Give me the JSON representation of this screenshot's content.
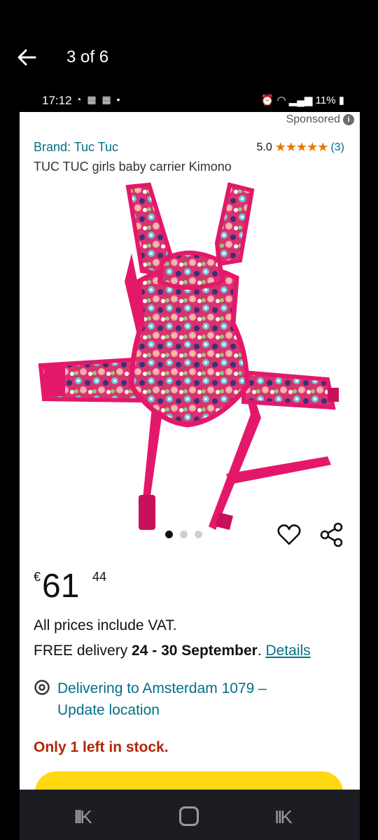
{
  "viewer": {
    "title": "3 of 6",
    "back_icon": "arrow-left-icon"
  },
  "status_bar": {
    "time": "17:12",
    "battery": "11%"
  },
  "product": {
    "sponsored": "Sponsored",
    "brand": "Brand: Tuc Tuc",
    "rating_value": "5.0",
    "stars": "★★★★★",
    "rating_count": "(3)",
    "title": "TUC TUC girls baby carrier Kimono",
    "image_count": 3,
    "active_image": 1
  },
  "price": {
    "currency": "€",
    "whole": "61",
    "fraction": "44"
  },
  "info": {
    "vat": "All prices include VAT.",
    "delivery_prefix": "FREE delivery ",
    "delivery_dates": "24 - 30 September",
    "delivery_suffix": ". ",
    "details_link": "Details",
    "location_line1": "Delivering to Amsterdam 1079 –",
    "location_line2": "Update location",
    "stock": "Only 1 left in stock."
  },
  "colors": {
    "link": "#007185",
    "stock": "#b12704",
    "button": "#ffd814",
    "star": "#e77600"
  }
}
